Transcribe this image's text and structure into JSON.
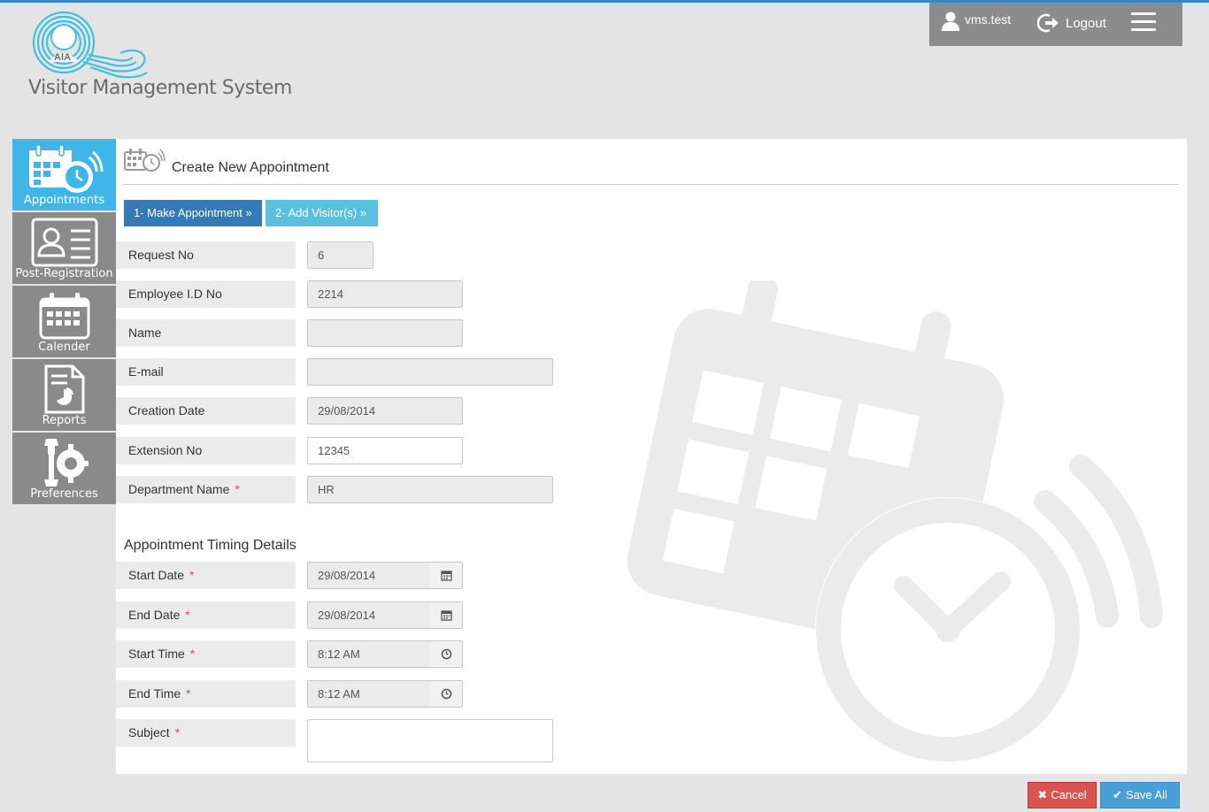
{
  "app": {
    "title": "Visitor Management System",
    "logo_text": "AIA"
  },
  "topbar": {
    "username": "vms.test",
    "logout_label": "Logout"
  },
  "sidebar": {
    "items": [
      {
        "label": "Appointments",
        "icon": "calendar-clock-icon",
        "active": true
      },
      {
        "label": "Post-Registration",
        "icon": "id-card-icon",
        "active": false
      },
      {
        "label": "Calender",
        "icon": "calendar-icon",
        "active": false
      },
      {
        "label": "Reports",
        "icon": "report-icon",
        "active": false
      },
      {
        "label": "Preferences",
        "icon": "gear-wrench-icon",
        "active": false
      }
    ]
  },
  "page": {
    "title": "Create New Appointment",
    "steps": [
      {
        "label": "1- Make Appointment »"
      },
      {
        "label": "2- Add Visitor(s) »"
      }
    ]
  },
  "form": {
    "request_no": {
      "label": "Request No",
      "value": "6"
    },
    "employee_id": {
      "label": "Employee I.D No",
      "value": "2214"
    },
    "name": {
      "label": "Name",
      "value": ""
    },
    "email": {
      "label": "E-mail",
      "value": ""
    },
    "creation_date": {
      "label": "Creation Date",
      "value": "29/08/2014"
    },
    "extension_no": {
      "label": "Extension No",
      "value": "12345"
    },
    "department_name": {
      "label": "Department Name",
      "value": "HR",
      "required": "*"
    }
  },
  "timing": {
    "section_title": "Appointment Timing Details",
    "start_date": {
      "label": "Start Date",
      "value": "29/08/2014",
      "required": "*"
    },
    "end_date": {
      "label": "End Date",
      "value": "29/08/2014",
      "required": "*"
    },
    "start_time": {
      "label": "Start Time",
      "value": "8:12 AM",
      "required": "*"
    },
    "end_time": {
      "label": "End Time",
      "value": "8:12 AM",
      "required": "*"
    },
    "subject": {
      "label": "Subject",
      "value": "",
      "required": "*"
    }
  },
  "actions": {
    "cancel_label": "Cancel",
    "save_label": "Save All"
  },
  "colors": {
    "accent": "#3fb6e6",
    "primary": "#337ab7",
    "info": "#5bc0de",
    "danger": "#d9534f",
    "sidebar": "#8a8a8a"
  }
}
